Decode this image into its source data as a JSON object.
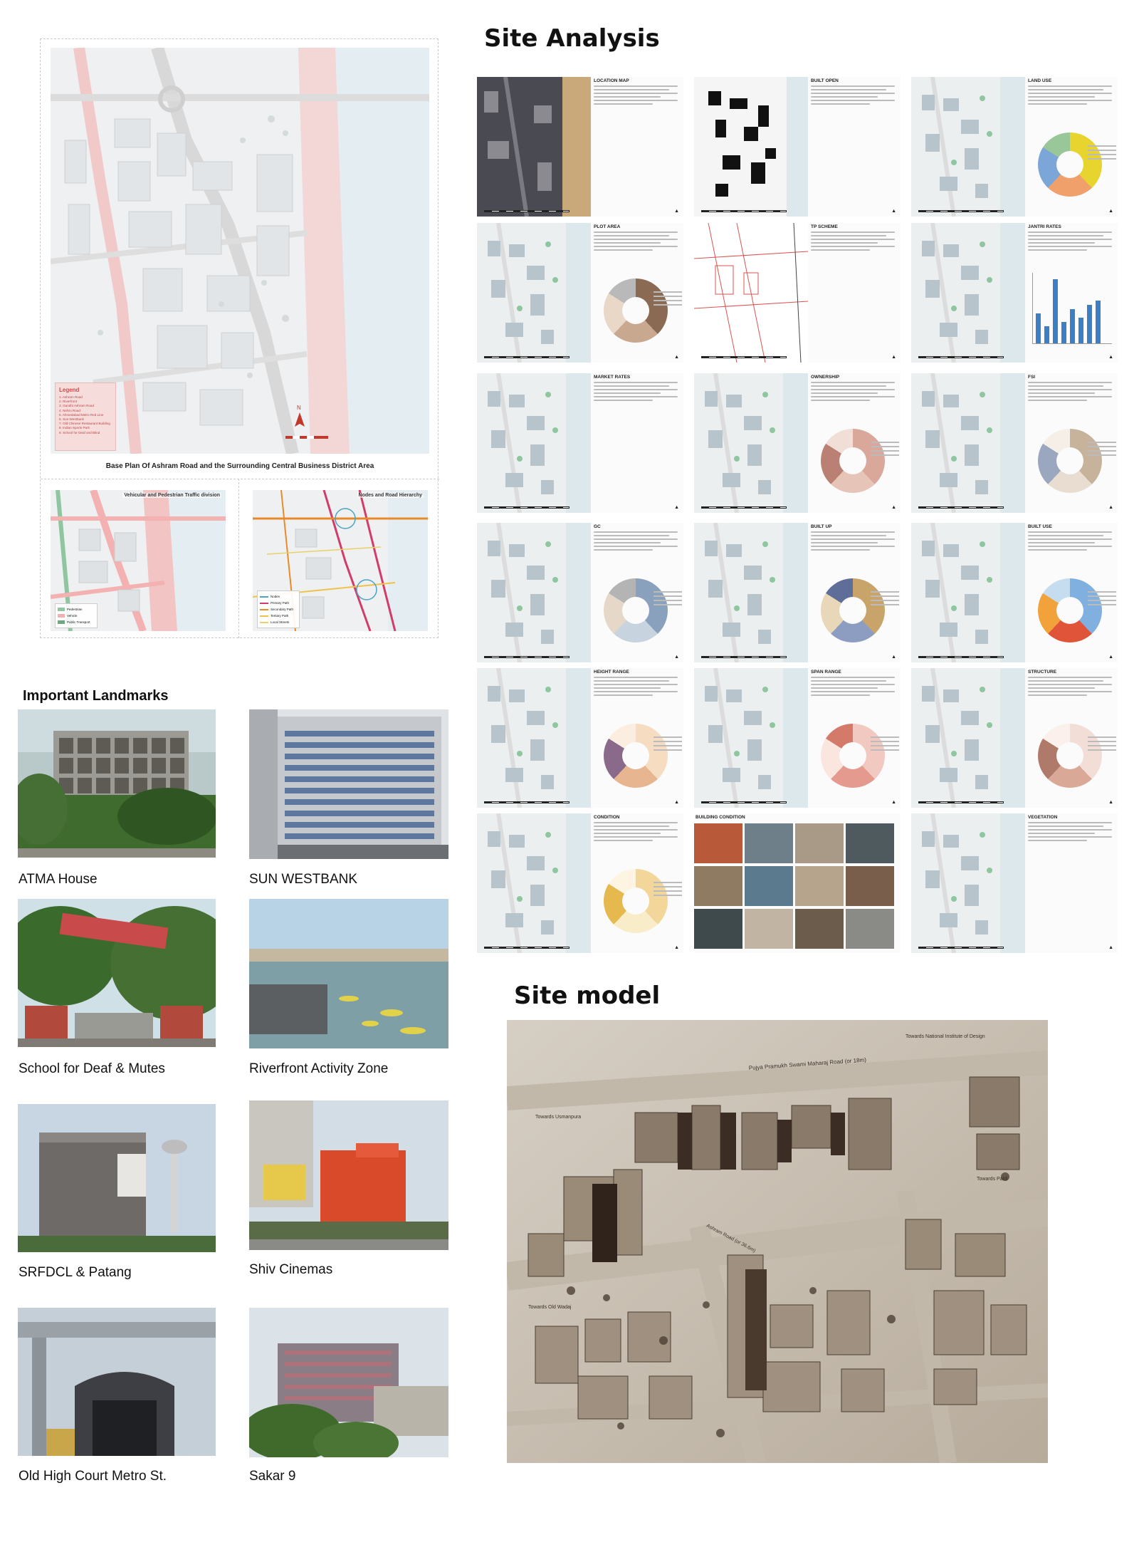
{
  "base_plan": {
    "caption": "Base Plan Of Ashram Road and the Surrounding Central Business District Area",
    "legend_title": "Legend",
    "legend_items": [
      "1. Ashram Road",
      "2. Riverfront",
      "3. Gandhi Ashram Road",
      "4. Nehru Road",
      "5. Ahmedabad Metro Red Line",
      "6. Sun Westbank",
      "7. Old Chinese Restaurant Building",
      "8. Indian Sports Park",
      "9. School for Deaf and Blind"
    ],
    "traffic_map": {
      "title": "Vehicular and Pedestrian Traffic division",
      "legend": [
        {
          "label": "Pedestrian",
          "color": "#8fc6a0"
        },
        {
          "label": "Vehicle",
          "color": "#f3b1b1"
        },
        {
          "label": "Public Transport",
          "color": "#6ea87e"
        }
      ]
    },
    "hierarchy_map": {
      "title": "Nodes and Road Hierarchy",
      "legend": [
        {
          "label": "Nodes",
          "color": "#4aa3c2"
        },
        {
          "label": "Primary Path",
          "color": "#d23b6a"
        },
        {
          "label": "Secondary Path",
          "color": "#e88a2a"
        },
        {
          "label": "Tertiary Path",
          "color": "#f0c24a"
        },
        {
          "label": "Local Streets",
          "color": "#e8d06a"
        }
      ]
    }
  },
  "site_analysis": {
    "title": "Site Analysis",
    "panels": [
      {
        "title": "LOCATION MAP",
        "kind": "aerial"
      },
      {
        "title": "BUILT OPEN",
        "kind": "figureground"
      },
      {
        "title": "LAND USE",
        "kind": "donut",
        "colors": [
          "#e8d42e",
          "#f0a06a",
          "#7da6d8",
          "#9ac79a"
        ]
      },
      {
        "title": "PLOT AREA",
        "kind": "donut",
        "colors": [
          "#8a6a52",
          "#c9a890",
          "#e9d7c8",
          "#b9b9b9"
        ]
      },
      {
        "title": "TP SCHEME",
        "kind": "tp"
      },
      {
        "title": "JANTRI RATES",
        "kind": "bars",
        "values": [
          35,
          20,
          75,
          25,
          40,
          30,
          45,
          50
        ]
      },
      {
        "title": "MARKET RATES",
        "kind": "map"
      },
      {
        "title": "OWNERSHIP",
        "kind": "donut",
        "colors": [
          "#d9a89a",
          "#e7c4b8",
          "#b98073",
          "#f1ded7"
        ]
      },
      {
        "title": "FSI",
        "kind": "donut",
        "colors": [
          "#c7b39b",
          "#e8ddd0",
          "#9aa7bf",
          "#f5efe7"
        ]
      },
      {
        "title": "GC",
        "kind": "donut",
        "colors": [
          "#8aa1bd",
          "#c8d3e0",
          "#e6d8c8",
          "#b4b4b4"
        ]
      },
      {
        "title": "BUILT UP",
        "kind": "donut",
        "colors": [
          "#c9a46a",
          "#8d9dc2",
          "#e8d7b8",
          "#5f6d99"
        ]
      },
      {
        "title": "BUILT USE",
        "kind": "donut",
        "colors": [
          "#7fb0e0",
          "#e0553a",
          "#f2a23a",
          "#c6dcef"
        ]
      },
      {
        "title": "HEIGHT RANGE",
        "kind": "donut",
        "colors": [
          "#f6dcc0",
          "#e7b58f",
          "#8a6a8a",
          "#fbeee0"
        ]
      },
      {
        "title": "SPAN RANGE",
        "kind": "donut",
        "colors": [
          "#f2c9c0",
          "#e49a8e",
          "#fbe5df",
          "#d47a6a"
        ]
      },
      {
        "title": "STRUCTURE",
        "kind": "donut",
        "colors": [
          "#f2ded7",
          "#d9a896",
          "#b07a6a",
          "#fbf0eb"
        ]
      },
      {
        "title": "CONDITION",
        "kind": "donut",
        "colors": [
          "#f3d79a",
          "#f9ecc8",
          "#e6b94f",
          "#fdf5e2"
        ]
      },
      {
        "title": "BUILDING CONDITION",
        "kind": "photos"
      },
      {
        "title": "VEGETATION",
        "kind": "map"
      }
    ]
  },
  "landmarks": {
    "title": "Important Landmarks",
    "items": [
      "ATMA House",
      "SUN WESTBANK",
      "School for Deaf & Mutes",
      "Riverfront Activity Zone",
      "SRFDCL & Patang",
      "Shiv Cinemas",
      "Old High Court Metro St.",
      "Sakar 9"
    ]
  },
  "site_model": {
    "title": "Site model",
    "labels": [
      "Pujya Pramukh Swami Maharaj Road (or 18m)",
      "Towards Usmanpura",
      "Towards Paldi",
      "Ashram Road (or 36.6m)",
      "Towards Old Wadaj",
      "Towards National Institute of Design"
    ]
  }
}
